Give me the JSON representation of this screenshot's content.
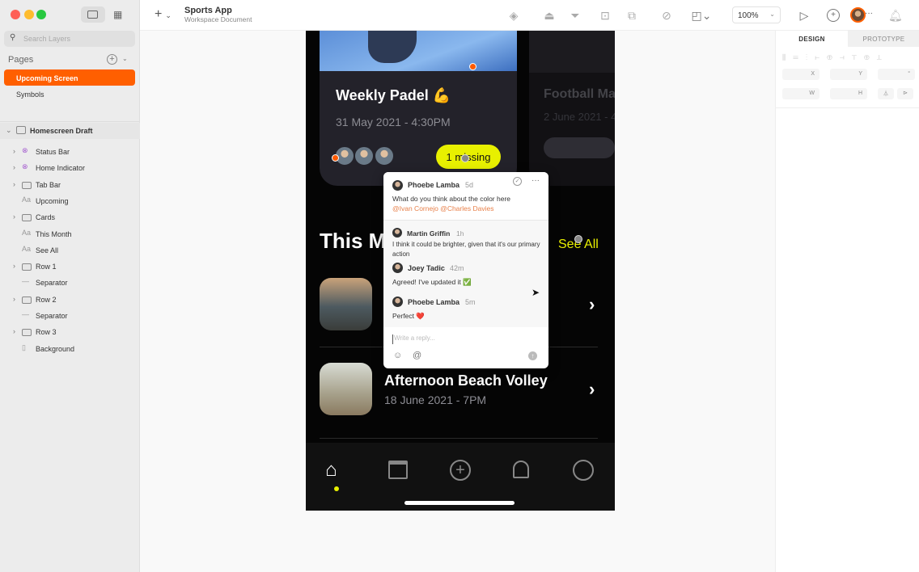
{
  "app": {
    "title": "Sports App",
    "subtitle": "Workspace Document",
    "zoom": "100%"
  },
  "sidebar": {
    "search_placeholder": "Search Layers",
    "pages_label": "Pages",
    "pages": [
      {
        "label": "Upcoming Screen",
        "selected": true
      },
      {
        "label": "Symbols"
      }
    ],
    "artboard": "Homescreen Draft",
    "layers": [
      {
        "label": "Status Bar",
        "type": "symbol"
      },
      {
        "label": "Home Indicator",
        "type": "symbol"
      },
      {
        "label": "Tab Bar",
        "type": "group"
      },
      {
        "label": "Upcoming",
        "type": "text"
      },
      {
        "label": "Cards",
        "type": "group"
      },
      {
        "label": "This Month",
        "type": "text"
      },
      {
        "label": "See All",
        "type": "text"
      },
      {
        "label": "Row 1",
        "type": "group"
      },
      {
        "label": "Separator",
        "type": "line"
      },
      {
        "label": "Row 2",
        "type": "group"
      },
      {
        "label": "Separator",
        "type": "line"
      },
      {
        "label": "Row 3",
        "type": "group"
      },
      {
        "label": "Background",
        "type": "rect"
      }
    ]
  },
  "inspector": {
    "tabs": [
      "DESIGN",
      "PROTOTYPE"
    ],
    "fields": {
      "x": "X",
      "y": "Y",
      "angle": "°",
      "w": "W",
      "h": "H"
    }
  },
  "phone": {
    "card1": {
      "title": "Weekly Padel 💪",
      "date": "31 May 2021 - 4:30PM",
      "badge": "1 missing"
    },
    "card2": {
      "title": "Football Ma",
      "date": "2 June 2021 - 4"
    },
    "section_title": "This Month",
    "see_all": "See All",
    "row2": {
      "title": "Afternoon Beach Volley",
      "date": "18 June 2021 - 7PM"
    }
  },
  "comments": {
    "thread": [
      {
        "author": "Phoebe Lamba",
        "time": "5d",
        "text": "What do you think about the color here",
        "mentions": "@Ivan Cornejo @Charles Davies"
      },
      {
        "author": "Martin Griffin",
        "time": "1h",
        "text": "I think it could be brighter, given that it's our primary action"
      },
      {
        "author": "Joey Tadic",
        "time": "42m",
        "text": "Agreed! I've updated it ✅"
      },
      {
        "author": "Phoebe Lamba",
        "time": "5m",
        "text": "Perfect ❤️"
      }
    ],
    "reply_placeholder": "Write a reply..."
  },
  "colors": {
    "accent": "#ff5f00",
    "highlight": "#e8f000",
    "mention": "#e8804a"
  }
}
